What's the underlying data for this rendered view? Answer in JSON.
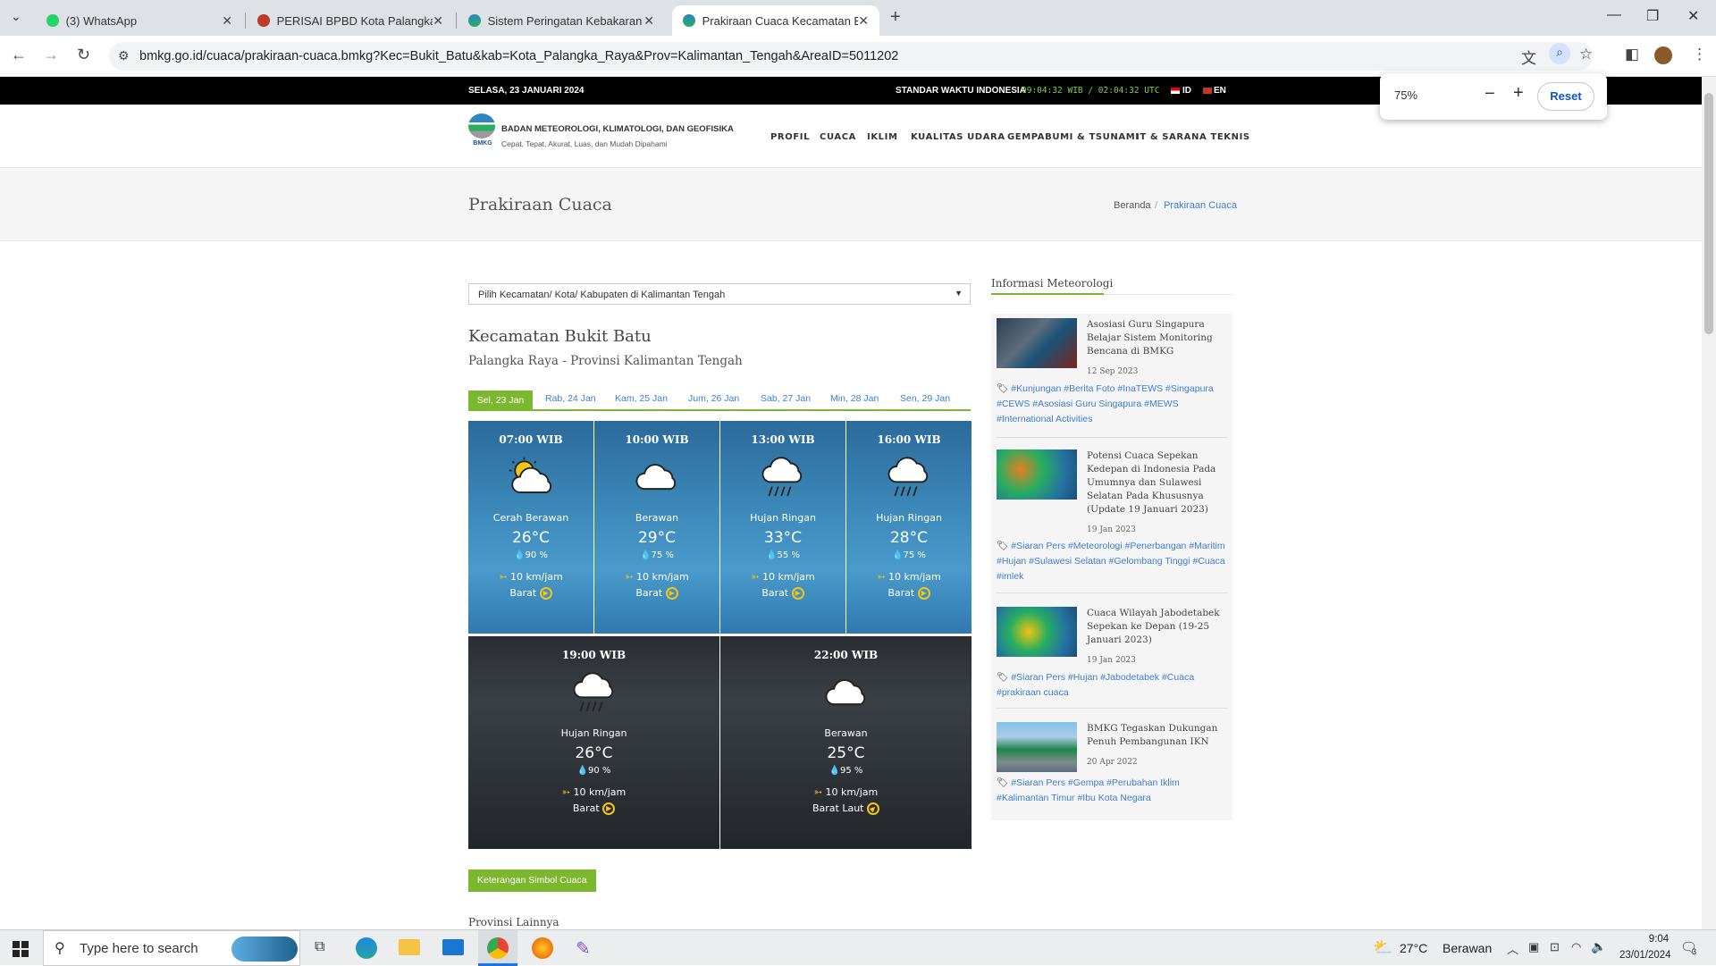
{
  "browser": {
    "tabs": [
      {
        "title": "(3) WhatsApp"
      },
      {
        "title": "PERISAI BPBD Kota Palangka Ra"
      },
      {
        "title": "Sistem Peringatan Kebakaran H"
      },
      {
        "title": "Prakiraan Cuaca Kecamatan Bu"
      }
    ],
    "url": "bmkg.go.id/cuaca/prakiraan-cuaca.bmkg?Kec=Bukit_Batu&kab=Kota_Palangka_Raya&Prov=Kalimantan_Tengah&AreaID=5011202",
    "zoom": {
      "value": "75%",
      "reset_label": "Reset"
    }
  },
  "topbar": {
    "date": "SELASA, 23 JANUARI 2024",
    "time_label": "STANDAR WAKTU INDONESIA",
    "time_value": "09:04:32 WIB / 02:04:32 UTC",
    "lang_id": "ID",
    "lang_en": "EN"
  },
  "header": {
    "org_name": "BADAN METEOROLOGI, KLIMATOLOGI, DAN GEOFISIKA",
    "tagline": "Cepat, Tepat, Akurat, Luas, dan Mudah Dipahami",
    "logo_text": "BMKG",
    "nav": [
      "PROFIL",
      "CUACA",
      "IKLIM",
      "KUALITAS UDARA",
      "GEMPABUMI & TSUNAMI",
      "IT & SARANA TEKNIS"
    ]
  },
  "page": {
    "title": "Prakiraan Cuaca",
    "breadcrumb_home": "Beranda",
    "breadcrumb_sep": "/",
    "breadcrumb_current": "Prakiraan Cuaca"
  },
  "main": {
    "select_placeholder": "Pilih Kecamatan/ Kota/ Kabupaten di Kalimantan Tengah",
    "location_title": "Kecamatan Bukit Batu",
    "location_subtitle": "Palangka Raya - Provinsi Kalimantan Tengah",
    "day_tabs": [
      "Sel, 23 Jan",
      "Rab, 24 Jan",
      "Kam, 25 Jan",
      "Jum, 26 Jan",
      "Sab, 27 Jan",
      "Min, 28 Jan",
      "Sen, 29 Jan"
    ],
    "forecasts": [
      {
        "time": "07:00 WIB",
        "condition": "Cerah Berawan",
        "temp": "26°C",
        "humidity": "90 %",
        "wind": "10 km/jam",
        "direction": "Barat"
      },
      {
        "time": "10:00 WIB",
        "condition": "Berawan",
        "temp": "29°C",
        "humidity": "75 %",
        "wind": "10 km/jam",
        "direction": "Barat"
      },
      {
        "time": "13:00 WIB",
        "condition": "Hujan Ringan",
        "temp": "33°C",
        "humidity": "55 %",
        "wind": "10 km/jam",
        "direction": "Barat"
      },
      {
        "time": "16:00 WIB",
        "condition": "Hujan Ringan",
        "temp": "28°C",
        "humidity": "75 %",
        "wind": "10 km/jam",
        "direction": "Barat"
      },
      {
        "time": "19:00 WIB",
        "condition": "Hujan Ringan",
        "temp": "26°C",
        "humidity": "90 %",
        "wind": "10 km/jam",
        "direction": "Barat"
      },
      {
        "time": "22:00 WIB",
        "condition": "Berawan",
        "temp": "25°C",
        "humidity": "95 %",
        "wind": "10 km/jam",
        "direction": "Barat Laut"
      }
    ],
    "legend_button": "Keterangan Simbol Cuaca",
    "other_provinces": "Provinsi Lainnya"
  },
  "sidebar": {
    "title": "Informasi Meteorologi",
    "news": [
      {
        "title": "Asosiasi Guru Singapura Belajar Sistem Monitoring Bencana di BMKG",
        "date": "12 Sep 2023",
        "tags": "#Kunjungan #Berita Foto #InaTEWS #Singapura #CEWS #Asosiasi Guru Singapura #MEWS #International Activities"
      },
      {
        "title": "Potensi Cuaca Sepekan Kedepan di Indonesia Pada Umumnya dan Sulawesi Selatan Pada Khususnya (Update 19 Januari 2023)",
        "date": "19 Jan 2023",
        "tags": "#Siaran Pers #Meteorologi #Penerbangan #Maritim #Hujan #Sulawesi Selatan #Gelombang Tinggi #Cuaca #imlek"
      },
      {
        "title": "Cuaca Wilayah Jabodetabek Sepekan ke Depan (19-25 Januari 2023)",
        "date": "19 Jan 2023",
        "tags": "#Siaran Pers #Hujan #Jabodetabek #Cuaca #prakiraan cuaca"
      },
      {
        "title": "BMKG Tegaskan Dukungan Penuh Pembangunan IKN",
        "date": "20 Apr 2022",
        "tags": "#Siaran Pers #Gempa #Perubahan Iklim #Kalimantan Timur #Ibu Kota Negara"
      }
    ]
  },
  "taskbar": {
    "search_placeholder": "Type here to search",
    "weather_temp": "27°C",
    "weather_text": "Berawan",
    "clock_time": "9:04",
    "clock_date": "23/01/2024",
    "notif_count": "3"
  },
  "colors": {
    "accent_green": "#7cb82f",
    "link_blue": "#3b7fd2",
    "topbar": "#000000"
  }
}
